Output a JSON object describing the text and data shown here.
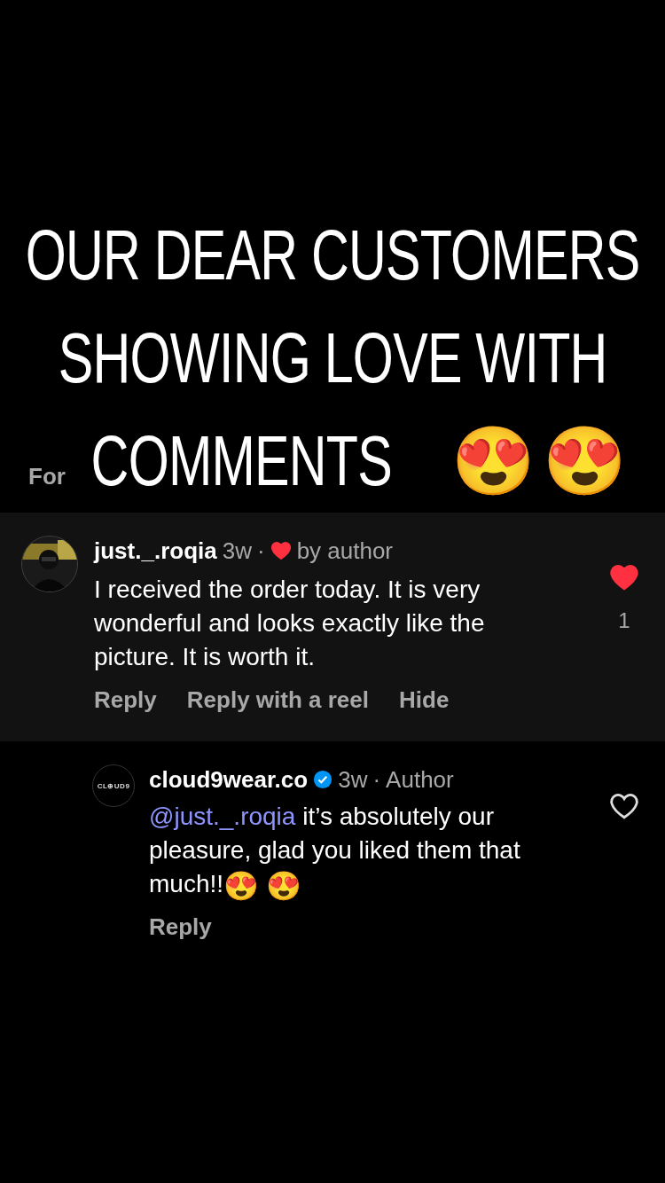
{
  "headline": {
    "lines": [
      "OUR DEAR CUSTOMERS",
      "SHOWING LOVE WITH",
      "COMMENTS"
    ],
    "emojis": [
      "😍",
      "😍"
    ]
  },
  "side_label": "For",
  "comment": {
    "username": "just._.roqia",
    "time": "3w",
    "separator": "·",
    "liked_by_author": true,
    "liked_label": "by author",
    "text": "I received the order today. It is very wonderful and looks exactly like the picture. It is worth it.",
    "liked": true,
    "like_count": "1",
    "actions": [
      "Reply",
      "Reply with a reel",
      "Hide"
    ]
  },
  "reply": {
    "username": "cloud9wear.co",
    "verified": true,
    "time": "3w",
    "separator": "·",
    "role": "Author",
    "avatar_text": "CL⊕UD9",
    "mention": "@just._.roqia",
    "text": " it’s absolutely our pleasure, glad you liked them that much!!",
    "emojis": [
      "😍",
      "😍"
    ],
    "liked": false,
    "actions": [
      "Reply"
    ]
  }
}
